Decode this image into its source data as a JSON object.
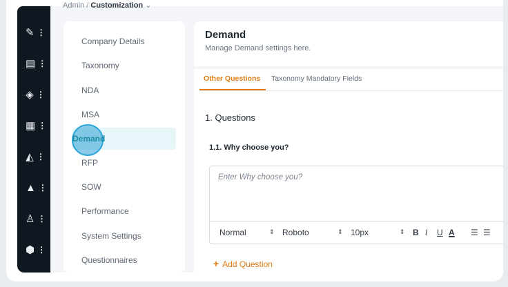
{
  "breadcrumb": {
    "parent": "Admin",
    "separator": "/",
    "current": "Customization",
    "chevron": "⌄"
  },
  "nav": [
    {
      "icon": "document-edit-icon",
      "glyph": "✎"
    },
    {
      "icon": "clipboard-icon",
      "glyph": "▤"
    },
    {
      "icon": "handshake-icon",
      "glyph": "◈"
    },
    {
      "icon": "building-icon",
      "glyph": "▦"
    },
    {
      "icon": "graduation-cap-icon",
      "glyph": "◭"
    },
    {
      "icon": "shapes-icon",
      "glyph": "▲"
    },
    {
      "icon": "user-icon",
      "glyph": "♙"
    },
    {
      "icon": "shield-icon",
      "glyph": "⬢"
    }
  ],
  "sidebar": {
    "items": [
      {
        "label": "Company Details"
      },
      {
        "label": "Taxonomy"
      },
      {
        "label": "NDA"
      },
      {
        "label": "MSA"
      },
      {
        "label": "Demand",
        "active": true
      },
      {
        "label": "RFP"
      },
      {
        "label": "SOW"
      },
      {
        "label": "Performance"
      },
      {
        "label": "System Settings"
      },
      {
        "label": "Questionnaires"
      }
    ]
  },
  "panel": {
    "title": "Demand",
    "subtitle": "Manage Demand settings here.",
    "tabs": [
      {
        "label": "Other Questions",
        "active": true
      },
      {
        "label": "Taxonomy Mandatory Fields"
      }
    ],
    "section_heading": "1. Questions",
    "question_label": "1.1. Why choose you?",
    "editor_placeholder": "Enter Why choose you?",
    "toolbar": {
      "format": "Normal",
      "font": "Roboto",
      "size": "10px",
      "bold": "B",
      "italic": "I",
      "underline": "U",
      "color": "A",
      "arrow": "⇕"
    },
    "add_question": "Add Question",
    "add_icon": "+"
  },
  "colors": {
    "accent": "#e07b10",
    "active_bg": "#e7f6f8",
    "active_text": "#1e8ea2",
    "nav_bg": "#0f1720"
  }
}
